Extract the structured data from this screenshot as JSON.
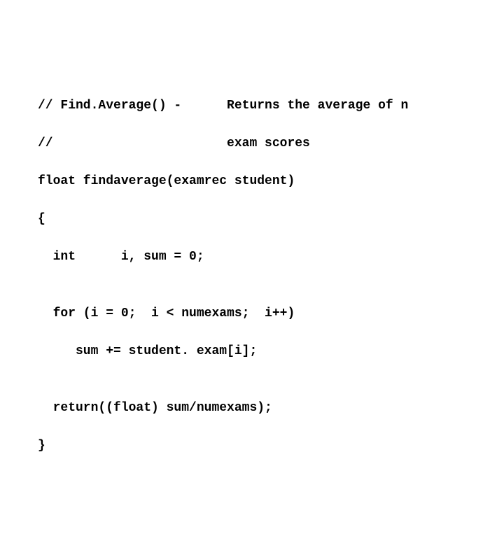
{
  "code": {
    "lines": [
      "// Find.Average() -      Returns the average of n",
      "//                       exam scores",
      "float findaverage(examrec student)",
      "{",
      "  int      i, sum = 0;",
      "",
      "  for (i = 0;  i < numexams;  i++)",
      "     sum += student. exam[i];",
      "",
      "  return((float) sum/numexams);",
      "}"
    ]
  }
}
